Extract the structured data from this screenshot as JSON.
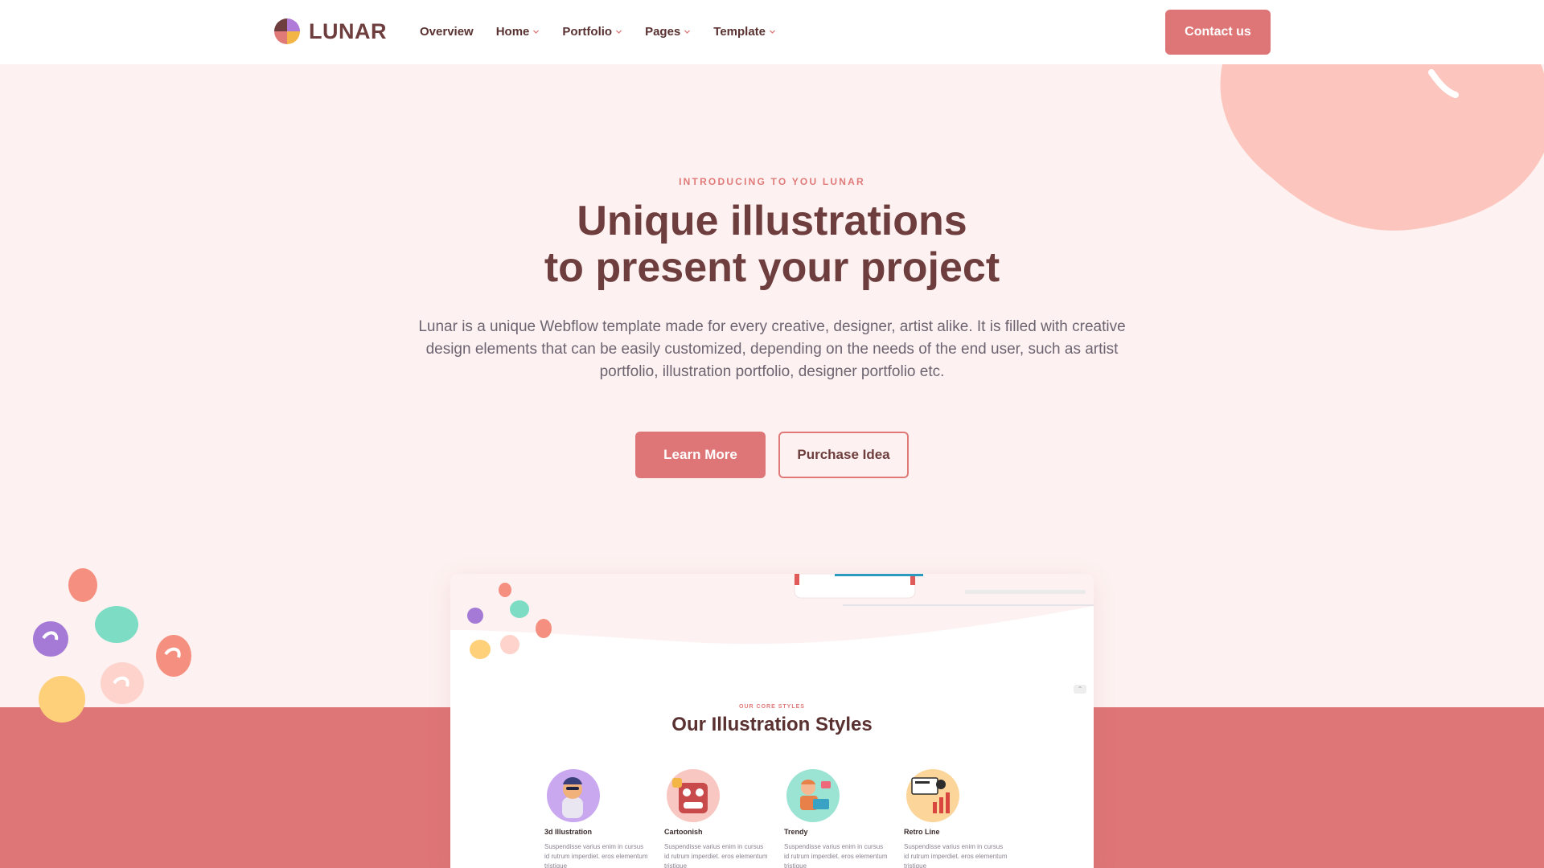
{
  "header": {
    "logo_text": "LUNAR",
    "nav": [
      {
        "label": "Overview",
        "has_dropdown": false
      },
      {
        "label": "Home",
        "has_dropdown": true
      },
      {
        "label": "Portfolio",
        "has_dropdown": true
      },
      {
        "label": "Pages",
        "has_dropdown": true
      },
      {
        "label": "Template",
        "has_dropdown": true
      }
    ],
    "contact_label": "Contact us"
  },
  "hero": {
    "eyebrow": "INTRODUCING TO YOU LUNAR",
    "title_line1": "Unique illustrations",
    "title_line2": "to present your project",
    "description": "Lunar is a unique Webflow template made for every creative, designer, artist alike. It is filled with creative design elements that can be easily customized, depending on the needs of the end user, such as artist portfolio, illustration portfolio, designer portfolio etc.",
    "learn_more_label": "Learn More",
    "purchase_label": "Purchase Idea"
  },
  "preview": {
    "eyebrow": "OUR CORE STYLES",
    "title": "Our Illustration Styles",
    "cards": [
      {
        "title": "3d Illustration",
        "text": "Suspendisse varius enim in cursus id rutrum imperdiet. eros elementum tristique",
        "icon": "3d-illustration-icon"
      },
      {
        "title": "Cartoonish",
        "text": "Suspendisse varius enim in cursus id rutrum imperdiet. eros elementum tristique",
        "icon": "cartoonish-icon"
      },
      {
        "title": "Trendy",
        "text": "Suspendisse varius enim in cursus id rutrum imperdiet. eros elementum tristique",
        "icon": "trendy-icon"
      },
      {
        "title": "Retro Line",
        "text": "Suspendisse varius enim in cursus id rutrum imperdiet. eros elementum tristique",
        "icon": "retro-line-icon"
      }
    ]
  },
  "colors": {
    "accent": "#de7576",
    "heading": "#6e3d3d",
    "background": "#fdf2f1",
    "blob_pink": "#fcc5bd"
  }
}
